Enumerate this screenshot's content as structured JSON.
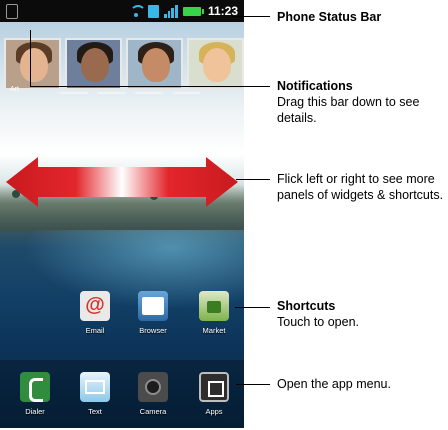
{
  "status_bar": {
    "time": "11:23"
  },
  "home_screen": {
    "notification_caption": "Art",
    "apps": [
      {
        "label": "Email",
        "icon": "email-icon"
      },
      {
        "label": "Browser",
        "icon": "browser-icon"
      },
      {
        "label": "Market",
        "icon": "market-icon"
      }
    ],
    "dock": [
      {
        "label": "Dialer",
        "icon": "dialer-icon"
      },
      {
        "label": "Text",
        "icon": "text-icon"
      },
      {
        "label": "Camera",
        "icon": "camera-icon"
      },
      {
        "label": "Apps",
        "icon": "apps-icon"
      }
    ]
  },
  "callouts": {
    "status_bar": {
      "title": "Phone Status Bar"
    },
    "notifications": {
      "title": "Notifications",
      "body": "Drag this bar down to see details."
    },
    "flick": {
      "body": "Flick left or right to see more panels of widgets & shortcuts."
    },
    "shortcuts": {
      "title": "Shortcuts",
      "body": "Touch to open."
    },
    "app_menu": {
      "body": "Open the app menu."
    }
  },
  "colors": {
    "arrow_red": "#e3262b",
    "status_icon_blue": "#39b7e8",
    "battery_green": "#39d34a"
  }
}
